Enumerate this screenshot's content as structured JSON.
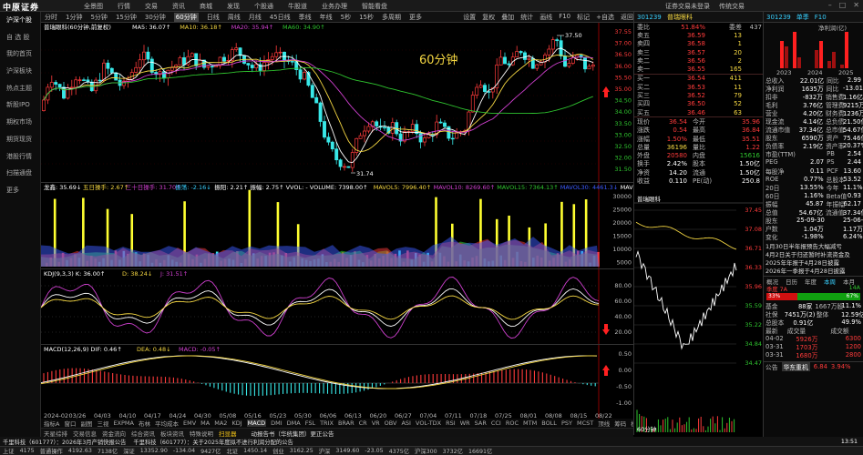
{
  "app": {
    "logo": "中原证券",
    "menu": [
      "全景图",
      "行情",
      "交易",
      "资讯",
      "商城",
      "发现",
      "个股通",
      "牛股道",
      "业务办理",
      "智能看盘"
    ],
    "top_right": [
      "证券交易未登录",
      "传统交易"
    ]
  },
  "sidebar": [
    "沪深个股",
    "自 选 股",
    "我的首页",
    "沪深板块",
    "热点主题",
    "新股IPO",
    "期权市场",
    "期货现货",
    "港股行情",
    "扫描通盘",
    "更多"
  ],
  "periodbar": {
    "items": [
      "分时",
      "1分钟",
      "5分钟",
      "15分钟",
      "30分钟",
      "60分钟",
      "日线",
      "周线",
      "月线",
      "45日线",
      "季线",
      "年线",
      "5秒",
      "15秒",
      "多周期",
      "更多"
    ],
    "selected": "60分钟",
    "tools": [
      "设置",
      "复权",
      "叠加",
      "统计",
      "画线",
      "F10",
      "标记",
      "+自选",
      "返回"
    ]
  },
  "main_chart": {
    "title": "普瑞眼科(60分钟,前复权)",
    "ma_labels": [
      {
        "text": "MA5: 36.07↑",
        "color": "#ffffff"
      },
      {
        "text": "MA10: 36.18↑",
        "color": "#f5d742"
      },
      {
        "text": "MA20: 35.94↑",
        "color": "#d040d0"
      },
      {
        "text": "MA60: 34.90↑",
        "color": "#2fc52f"
      }
    ],
    "watermark": "60分钟",
    "high_label": "37.50",
    "low_label": "31.74",
    "y_ticks": [
      "37.55",
      "37.00",
      "36.50",
      "36.00",
      "35.50",
      "35.00",
      "34.50",
      "34.00",
      "33.50",
      "33.00",
      "32.50",
      "32.00",
      "31.50"
    ]
  },
  "vol_chart": {
    "labels": [
      {
        "text": "龙鑫: 35.69↓",
        "color": "#ffffff"
      },
      {
        "text": "五日操手: 2.67↑",
        "color": "#f5d742"
      },
      {
        "text": "三十日操手: 31.70↑",
        "color": "#d040d0"
      },
      {
        "text": "振荡: -2.16↓",
        "color": "#38d0ff"
      },
      {
        "text": "振阳: 2.21↑",
        "color": "#ffffff"
      },
      {
        "text": "振幅: 2.75↑",
        "color": "#ffffff"
      },
      {
        "text": "VVOL: - VOLUME: 7398.00↑",
        "color": "#ffffff"
      },
      {
        "text": "MAVOL5: 7996.40↑",
        "color": "#f5d742"
      },
      {
        "text": "MAVOL10: 8269.60↑",
        "color": "#d040d0"
      },
      {
        "text": "MAVOL15: 7364.13↑",
        "color": "#2fc52f"
      },
      {
        "text": "MAVOL30: 4461.3↓",
        "color": "#3b5bff"
      },
      {
        "text": "MAVOL60: 5480.88↓",
        "color": "#ffffff"
      }
    ],
    "y_ticks": [
      "30000",
      "25000",
      "20000",
      "15000",
      "10000",
      "5000"
    ]
  },
  "kdj_chart": {
    "labels": [
      {
        "text": "KDJ(9,3,3) K: 36.00↑",
        "color": "#ffffff"
      },
      {
        "text": "D: 38.24↓",
        "color": "#f5d742"
      },
      {
        "text": "J: 31.51↑",
        "color": "#d040d0"
      }
    ],
    "y_ticks": [
      "80.00",
      "60.00",
      "40.00",
      "20.00"
    ]
  },
  "macd_chart": {
    "labels": [
      {
        "text": "MACD(12,26,9) DIF: 0.46↑",
        "color": "#ffffff"
      },
      {
        "text": "DEA: 0.48↓",
        "color": "#f5d742"
      },
      {
        "text": "MACD: -0.05↑",
        "color": "#d040d0"
      }
    ],
    "y_ticks": [
      "0.50",
      "0.00",
      "-0.50",
      "-1.00"
    ],
    "x_ticks": [
      "2024-02",
      "03/26",
      "04/03",
      "04/10",
      "04/17",
      "04/24",
      "04/30",
      "05/08",
      "05/16",
      "05/23",
      "05/30",
      "06/06",
      "06/13",
      "06/20",
      "06/27",
      "07/04",
      "07/11",
      "07/18",
      "07/25",
      "08/01",
      "08/08",
      "08/15",
      "08/22"
    ]
  },
  "bottom_tabs": [
    "指标A",
    "窗口",
    "副图",
    "三视",
    "EXPMA",
    "布林",
    "平均成本",
    "EMV",
    "MA",
    "MA2",
    "KDJ",
    "MACD",
    "DMI",
    "DMA",
    "FSL",
    "TRIX",
    "BRAR",
    "CR",
    "VR",
    "OBV",
    "ASI",
    "VOL-TDX",
    "RSI",
    "WR",
    "SAR",
    "CCI",
    "ROC",
    "MTM",
    "BOLL",
    "PSY",
    "MCST",
    "顶线",
    "筹码",
    "模板"
  ],
  "bottom_tabs_active": "MACD",
  "bottom_tabs2": [
    "天星综排",
    "交易信息",
    "资金流向",
    "综合资讯",
    "板块资讯",
    "特殊说明",
    "扫显器"
  ],
  "bottom_tabs2_active": "扫显器",
  "bottom_info": "动报告书（华统集团）更正公告",
  "quote": {
    "code": "301239",
    "name": "普瑞眼科",
    "weibi_label": "委比",
    "weibi": "51.84%",
    "weicha_label": "委差",
    "weicha": "437",
    "sells": [
      {
        "label": "卖五",
        "price": "36.59",
        "vol": "13"
      },
      {
        "label": "卖四",
        "price": "36.58",
        "vol": "1"
      },
      {
        "label": "卖三",
        "price": "36.57",
        "vol": "20"
      },
      {
        "label": "卖二",
        "price": "36.56",
        "vol": "2"
      },
      {
        "label": "卖一",
        "price": "36.55",
        "vol": "165"
      }
    ],
    "buys": [
      {
        "label": "买一",
        "price": "36.54",
        "vol": "411"
      },
      {
        "label": "买二",
        "price": "36.53",
        "vol": "11"
      },
      {
        "label": "买三",
        "price": "36.52",
        "vol": "79"
      },
      {
        "label": "买四",
        "price": "36.50",
        "vol": "52"
      },
      {
        "label": "买五",
        "price": "36.46",
        "vol": "63"
      }
    ],
    "stats": [
      {
        "a": "现价",
        "b": "36.54",
        "bc": "red",
        "c": "今开",
        "d": "35.96",
        "dc": "red"
      },
      {
        "a": "涨跌",
        "b": "0.54",
        "bc": "red",
        "c": "最高",
        "d": "36.84",
        "dc": "red"
      },
      {
        "a": "涨幅",
        "b": "1.50%",
        "bc": "red",
        "c": "最低",
        "d": "35.51",
        "dc": "red"
      },
      {
        "a": "总量",
        "b": "36196",
        "bc": "yel",
        "c": "量比",
        "d": "1.22",
        "dc": "red"
      },
      {
        "a": "外盘",
        "b": "20580",
        "bc": "red",
        "c": "内盘",
        "d": "15616",
        "dc": "green"
      },
      {
        "a": "换手",
        "b": "2.42%",
        "bc": "wht",
        "c": "股本",
        "d": "1.50亿",
        "dc": "wht"
      },
      {
        "a": "净资",
        "b": "14.20",
        "bc": "wht",
        "c": "流通",
        "d": "1.50亿",
        "dc": "wht"
      },
      {
        "a": "收益",
        "b": "0.110",
        "bc": "wht",
        "c": "PE(动)",
        "d": "250.8",
        "dc": "wht"
      }
    ]
  },
  "mini": {
    "title": "普瑞眼科",
    "y_ticks": [
      "37.45",
      "37.08",
      "36.71",
      "36.33",
      "35.96",
      "35.59",
      "35.22",
      "34.84",
      "34.47"
    ],
    "y_ticks_colors": [
      "red",
      "red",
      "red",
      "red",
      "red",
      "green",
      "green",
      "green",
      "green"
    ],
    "volume_label": "60分钟"
  },
  "fpanel": {
    "header": {
      "code": "301239",
      "tabs": [
        "单季",
        "F10"
      ]
    },
    "rev_title": "净利润(亿)",
    "years": [
      "2023",
      "2024",
      "2025"
    ],
    "rows": [
      {
        "a": "总收入",
        "b": "22.01亿",
        "c": "同比",
        "d": "2.99"
      },
      {
        "a": "净利润",
        "b": "1635万",
        "c": "同比",
        "d": "-13.01"
      },
      {
        "a": "扣非",
        "b": "-832万",
        "c": "销售费",
        "d": "1.16亿"
      },
      {
        "a": "毛利",
        "b": "3.76亿",
        "c": "管理费",
        "d": "9215万"
      },
      {
        "a": "营业",
        "b": "4.20亿",
        "c": "财务费",
        "d": "1236万"
      },
      {
        "a": "现金流",
        "b": "4.14亿",
        "c": "总负债",
        "d": "21.50亿"
      },
      {
        "a": "流通市值",
        "b": "37.34亿",
        "c": "总市值",
        "d": "54.67亿"
      },
      {
        "a": "股东",
        "b": "6590万",
        "c": "资产",
        "d": "75.46亿"
      },
      {
        "a": "负债率",
        "b": "2.19亿",
        "c": "资产率",
        "d": "20.37%"
      },
      {
        "a": "市盈(TTM)",
        "b": "",
        "c": "PB",
        "d": "2.54"
      },
      {
        "a": "PEG",
        "b": "2.07",
        "c": "PS",
        "d": "2.44"
      },
      {
        "a": "每股净",
        "b": "0.11",
        "c": "PCF",
        "d": "13.60"
      },
      {
        "a": "ROE",
        "b": "0.77%",
        "c": "总股本",
        "d": "53.52"
      },
      {
        "a": "20日",
        "b": "13.55%",
        "c": "今年",
        "d": "11.1%"
      },
      {
        "a": "60日",
        "b": "1.16%",
        "c": "Beta值",
        "d": "0.93"
      },
      {
        "a": "振幅",
        "b": "45.87",
        "c": "年振幅",
        "d": "62.17"
      },
      {
        "a": "总值",
        "b": "54.67亿",
        "c": "流通值",
        "d": "37.34亿"
      },
      {
        "a": "股东",
        "b": "25-09-30",
        "c": "",
        "d": "25-06-30"
      },
      {
        "a": "户数",
        "b": "1.04万",
        "c": "",
        "d": "1.17万"
      },
      {
        "a": "变化",
        "b": "-1.98%",
        "c": "",
        "d": "6.24%"
      }
    ],
    "notes": [
      "1月30日半年报预告大幅减亏",
      "4月2日关于归还暂时补流资金及",
      "2025年年报于4月28日披露",
      "2026年一季报于4月28日披露"
    ],
    "tabs2": [
      "概况",
      "日历",
      "年度",
      "本周",
      "本月"
    ],
    "bar_left_label": "季度 7A",
    "bar_right_label": "14A",
    "bar_left": "33%",
    "bar_right": "67%",
    "stats2": [
      {
        "a": "基金",
        "b": "88家",
        "c": "1667万股",
        "d": "11.1%"
      },
      {
        "a": "社保",
        "b": "7451万(2)",
        "c": "整体",
        "d": "12.59亿(2)"
      },
      {
        "a": "总股本",
        "b": "0.91亿",
        "c": "",
        "d": "49.9%"
      }
    ],
    "trades_header": [
      "最新",
      "成交量",
      "",
      "成交额"
    ],
    "trades": [
      {
        "d": "04-02",
        "v": "5926万",
        "vc": "red",
        "m": "6300"
      },
      {
        "d": "03-31",
        "v": "1703万",
        "vc": "red",
        "m": "1200"
      },
      {
        "d": "03-31",
        "v": "1680万",
        "vc": "red",
        "m": "2800"
      }
    ],
    "footer": {
      "label": "公告",
      "sub": "华东重机",
      "price": "6.84",
      "pct": "3.94%"
    }
  },
  "status1": [
    {
      "t": "上证",
      "c": "wht"
    },
    {
      "t": "4175",
      "c": "red"
    },
    {
      "t": "普通操作",
      "c": "wht"
    },
    {
      "t": "4192.63",
      "c": "red"
    },
    {
      "t": "7138亿",
      "c": "wht"
    },
    {
      "t": "深证",
      "c": "wht"
    },
    {
      "t": "13352.90",
      "c": "green"
    },
    {
      "t": "-134.04",
      "c": "green"
    },
    {
      "t": "9427亿",
      "c": "wht"
    },
    {
      "t": "北证",
      "c": "wht"
    },
    {
      "t": "1450.14",
      "c": "green"
    },
    {
      "t": "创业",
      "c": "wht"
    },
    {
      "t": "3162.25",
      "c": "green"
    },
    {
      "t": "沪深",
      "c": "wht"
    },
    {
      "t": "3149.60",
      "c": "green"
    },
    {
      "t": "-23.05",
      "c": "green"
    },
    {
      "t": "4375亿",
      "c": "wht"
    },
    {
      "t": "沪深300",
      "c": "wht"
    },
    {
      "t": "3732亿",
      "c": "wht"
    },
    {
      "t": "16691亿",
      "c": "wht"
    }
  ],
  "status2": [
    "千里科技（601777）：2026年3月产销快报公告",
    "千里科技（601777）：关于2025年度拟不进行利润分配的公告"
  ],
  "status2_time": "13:51"
}
